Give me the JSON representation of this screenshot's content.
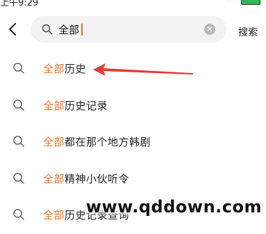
{
  "status_bar": {
    "time": "上午9:29"
  },
  "search": {
    "value": "全部",
    "button_label": "搜索"
  },
  "suggestions": [
    {
      "highlight": "全部",
      "rest": "历史"
    },
    {
      "highlight": "全部",
      "rest": "历史记录"
    },
    {
      "highlight": "全部",
      "rest": "都在那个地方韩剧"
    },
    {
      "highlight": "全部",
      "rest": "精神小伙听令"
    },
    {
      "highlight": "全部",
      "rest": "历史记录查询"
    }
  ],
  "watermark": "www.qddown.com",
  "colors": {
    "highlight": "#e0762a",
    "arrow": "#e53935"
  },
  "icons": [
    "back-icon",
    "search-icon",
    "clear-icon",
    "signal-icon",
    "wifi-icon",
    "battery-icon"
  ]
}
